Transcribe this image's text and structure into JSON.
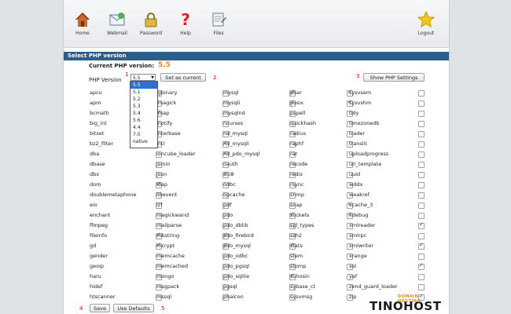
{
  "toolbar": {
    "items": [
      {
        "label": "Home",
        "icon": "home-icon"
      },
      {
        "label": "Webmail",
        "icon": "webmail-icon"
      },
      {
        "label": "Password",
        "icon": "password-icon"
      },
      {
        "label": "Help",
        "icon": "help-icon"
      },
      {
        "label": "Files",
        "icon": "files-icon"
      }
    ],
    "logout_label": "Logout"
  },
  "section_title": "Select PHP version",
  "current_version_label": "Current PHP version:",
  "current_version_value": "5.5",
  "php_version_label": "PHP Version",
  "selected_version": "5.5",
  "version_options": [
    "5.5",
    "5.1",
    "5.2",
    "5.3",
    "5.4",
    "5.6",
    "4.4",
    "7.0",
    "native"
  ],
  "buttons": {
    "set_as_current": "Set as current",
    "show_settings": "Show PHP Settings",
    "save": "Save",
    "use_defaults": "Use Defaults"
  },
  "step_numbers": {
    "one": "1",
    "two": "2",
    "three": "3",
    "four": "4",
    "five": "5"
  },
  "extensions": [
    [
      {
        "name": "apcu",
        "checked": false
      },
      {
        "name": "igbinary",
        "checked": false
      },
      {
        "name": "mysql",
        "checked": true
      },
      {
        "name": "phar",
        "checked": true
      },
      {
        "name": "sysvsem",
        "checked": false
      }
    ],
    [
      {
        "name": "apm",
        "checked": false
      },
      {
        "name": "imagick",
        "checked": false
      },
      {
        "name": "mysqli",
        "checked": true
      },
      {
        "name": "posix",
        "checked": true
      },
      {
        "name": "sysvshm",
        "checked": false
      }
    ],
    [
      {
        "name": "bcmath",
        "checked": true
      },
      {
        "name": "imap",
        "checked": false
      },
      {
        "name": "mysqlnd",
        "checked": false
      },
      {
        "name": "pspell",
        "checked": false
      },
      {
        "name": "tidy",
        "checked": false
      }
    ],
    [
      {
        "name": "big_int",
        "checked": false
      },
      {
        "name": "inotify",
        "checked": false
      },
      {
        "name": "ncurses",
        "checked": false
      },
      {
        "name": "quickhash",
        "checked": false
      },
      {
        "name": "timezonedb",
        "checked": false
      }
    ],
    [
      {
        "name": "bitset",
        "checked": false
      },
      {
        "name": "interbase",
        "checked": false
      },
      {
        "name": "nd_mysql",
        "checked": false
      },
      {
        "name": "radius",
        "checked": false
      },
      {
        "name": "trader",
        "checked": false
      }
    ],
    [
      {
        "name": "bz2_filter",
        "checked": false
      },
      {
        "name": "intl",
        "checked": true
      },
      {
        "name": "nd_mysqli",
        "checked": false
      },
      {
        "name": "raphf",
        "checked": false
      },
      {
        "name": "translit",
        "checked": false
      }
    ],
    [
      {
        "name": "dba",
        "checked": false
      },
      {
        "name": "ioncube_loader",
        "checked": true
      },
      {
        "name": "nd_pdo_mysql",
        "checked": false
      },
      {
        "name": "rar",
        "checked": false
      },
      {
        "name": "uploadprogress",
        "checked": false
      }
    ],
    [
      {
        "name": "dbase",
        "checked": false
      },
      {
        "name": "jsmin",
        "checked": false
      },
      {
        "name": "oauth",
        "checked": false
      },
      {
        "name": "recode",
        "checked": false
      },
      {
        "name": "uri_template",
        "checked": false
      }
    ],
    [
      {
        "name": "dbx",
        "checked": false
      },
      {
        "name": "json",
        "checked": true
      },
      {
        "name": "oci8",
        "checked": false
      },
      {
        "name": "redis",
        "checked": false
      },
      {
        "name": "uuid",
        "checked": false
      }
    ],
    [
      {
        "name": "dom",
        "checked": true
      },
      {
        "name": "ldap",
        "checked": false
      },
      {
        "name": "odbc",
        "checked": false
      },
      {
        "name": "rsync",
        "checked": false
      },
      {
        "name": "wddx",
        "checked": false
      }
    ],
    [
      {
        "name": "doublemetaphone",
        "checked": false
      },
      {
        "name": "libevent",
        "checked": false
      },
      {
        "name": "opcache",
        "checked": false
      },
      {
        "name": "snmp",
        "checked": false
      },
      {
        "name": "weakref",
        "checked": false
      }
    ],
    [
      {
        "name": "eio",
        "checked": false
      },
      {
        "name": "lzf",
        "checked": false
      },
      {
        "name": "pdf",
        "checked": false
      },
      {
        "name": "soap",
        "checked": true
      },
      {
        "name": "xcache_3",
        "checked": false
      }
    ],
    [
      {
        "name": "enchant",
        "checked": false
      },
      {
        "name": "magickwand",
        "checked": false
      },
      {
        "name": "pdo",
        "checked": true
      },
      {
        "name": "sockets",
        "checked": true
      },
      {
        "name": "xdebug",
        "checked": false
      }
    ],
    [
      {
        "name": "ffmpeg",
        "checked": false
      },
      {
        "name": "mailparse",
        "checked": false
      },
      {
        "name": "pdo_dblib",
        "checked": false
      },
      {
        "name": "spl_types",
        "checked": false
      },
      {
        "name": "xmlreader",
        "checked": true
      }
    ],
    [
      {
        "name": "fileinfo",
        "checked": true
      },
      {
        "name": "mbstring",
        "checked": true
      },
      {
        "name": "pdo_firebird",
        "checked": false
      },
      {
        "name": "ssh2",
        "checked": false
      },
      {
        "name": "xmlrpc",
        "checked": false
      }
    ],
    [
      {
        "name": "gd",
        "checked": true
      },
      {
        "name": "mcrypt",
        "checked": true
      },
      {
        "name": "pdo_mysql",
        "checked": true
      },
      {
        "name": "stats",
        "checked": false
      },
      {
        "name": "xmlwriter",
        "checked": true
      }
    ],
    [
      {
        "name": "gender",
        "checked": false
      },
      {
        "name": "memcache",
        "checked": false
      },
      {
        "name": "pdo_odbc",
        "checked": false
      },
      {
        "name": "stem",
        "checked": false
      },
      {
        "name": "xrange",
        "checked": false
      }
    ],
    [
      {
        "name": "geoip",
        "checked": false
      },
      {
        "name": "memcached",
        "checked": false
      },
      {
        "name": "pdo_pgsql",
        "checked": false
      },
      {
        "name": "stomp",
        "checked": false
      },
      {
        "name": "xsl",
        "checked": true
      }
    ],
    [
      {
        "name": "haru",
        "checked": false
      },
      {
        "name": "mongo",
        "checked": false
      },
      {
        "name": "pdo_sqlite",
        "checked": true
      },
      {
        "name": "suhosin",
        "checked": false
      },
      {
        "name": "yaf",
        "checked": false
      }
    ],
    [
      {
        "name": "hidef",
        "checked": false
      },
      {
        "name": "msgpack",
        "checked": false
      },
      {
        "name": "pgsql",
        "checked": false
      },
      {
        "name": "sybase_ct",
        "checked": false
      },
      {
        "name": "zend_guard_loader",
        "checked": false
      }
    ],
    [
      {
        "name": "htscanner",
        "checked": false
      },
      {
        "name": "mssql",
        "checked": false
      },
      {
        "name": "phalcon",
        "checked": false
      },
      {
        "name": "sysvmsg",
        "checked": false
      },
      {
        "name": "zip",
        "checked": true
      }
    ]
  ],
  "watermark": {
    "brand": "TINOHOST",
    "sub": "DOMAIN - HOSTING"
  },
  "colors": {
    "section_bar": "#2e5d86",
    "current_version": "#e88a0c",
    "step_number": "#dd0000",
    "selected_option": "#2f6fd0"
  }
}
